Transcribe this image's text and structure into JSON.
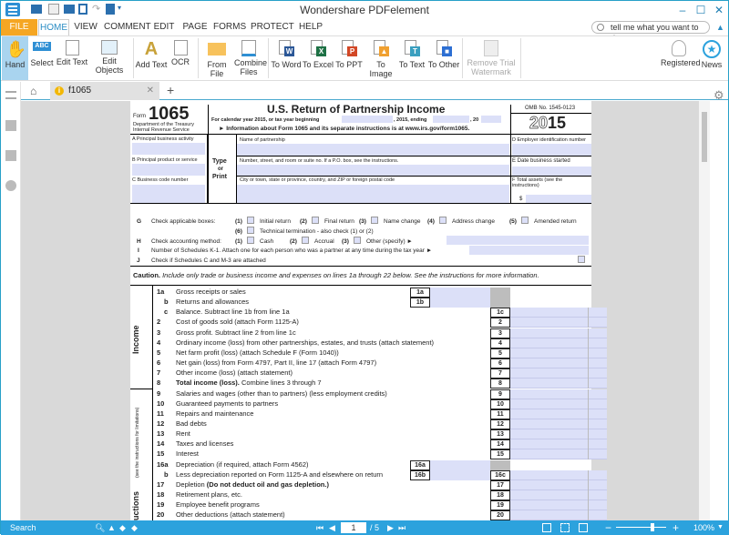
{
  "app": {
    "title": "Wondershare PDFelement",
    "window_controls": {
      "minimize": "–",
      "maximize": "☐",
      "close": "✕"
    }
  },
  "quick_access": [
    "open-icon",
    "save-icon",
    "print-icon",
    "find-icon",
    "redo-icon",
    "export-icon",
    "customize-dropdown-icon"
  ],
  "menu": {
    "tabs": [
      "FILE",
      "HOME",
      "VIEW",
      "COMMENT",
      "EDIT",
      "PAGE",
      "FORMS",
      "PROTECT",
      "HELP"
    ],
    "active": "HOME",
    "search_placeholder": "tell me what you want to do"
  },
  "ribbon": {
    "buttons": [
      {
        "label": "Hand",
        "icon": "hand-icon",
        "selected": true
      },
      {
        "label": "Select",
        "icon": "select-text-icon"
      },
      {
        "label": "Edit Text",
        "icon": "edit-text-icon"
      },
      {
        "label": "Edit Objects",
        "icon": "edit-objects-icon"
      },
      {
        "label": "Add Text",
        "icon": "add-text-icon"
      },
      {
        "label": "OCR",
        "icon": "ocr-icon"
      },
      {
        "label": "From File",
        "icon": "folder-icon"
      },
      {
        "label": "Combine Files",
        "icon": "combine-files-icon"
      },
      {
        "label": "To Word",
        "icon": "word-icon",
        "badge": "W",
        "color": "#2b5797"
      },
      {
        "label": "To Excel",
        "icon": "excel-icon",
        "badge": "X",
        "color": "#1e7145"
      },
      {
        "label": "To PPT",
        "icon": "ppt-icon",
        "badge": "P",
        "color": "#d24726"
      },
      {
        "label": "To Image",
        "icon": "image-icon",
        "badge": "▲",
        "color": "#f0a030"
      },
      {
        "label": "To Text",
        "icon": "text-icon",
        "badge": "T",
        "color": "#3a9fbf"
      },
      {
        "label": "To Other",
        "icon": "other-format-icon",
        "badge": "■",
        "color": "#2d6fd3"
      },
      {
        "label": "Remove Trial Watermark",
        "icon": "remove-watermark-icon",
        "disabled": true
      },
      {
        "label": "Registered",
        "icon": "registered-user-icon"
      },
      {
        "label": "News",
        "icon": "news-star-icon"
      }
    ]
  },
  "document_tabs": {
    "home_icon": "home-icon",
    "tabs": [
      {
        "label": "f1065",
        "icon": "info-icon"
      }
    ],
    "close": "✕",
    "add": "+"
  },
  "form": {
    "form_label": "Form",
    "form_number": "1065",
    "department": "Department of the Treasury",
    "service": "Internal Revenue Service",
    "title": "U.S. Return of Partnership Income",
    "year_line": "For calendar year 2015, or tax year beginning",
    "year_mid": ", 2015, ending",
    "year_end": ", 20",
    "info_line": "► Information about Form 1065 and its separate instructions is at www.irs.gov/form1065.",
    "omb": "OMB No. 1545-0123",
    "year": "2015",
    "year_prefix": "20",
    "year_suffix": "15",
    "A": "A  Principal business activity",
    "B": "B  Principal product or service",
    "C": "C  Business code number",
    "type_or_print": [
      "Type",
      "or",
      "Print"
    ],
    "name_label": "Name of partnership",
    "street_label": "Number, street, and room or suite no. If a P.O. box, see the instructions.",
    "city_label": "City or town, state or province, country, and ZIP or foreign postal code",
    "D": "D  Employer identification number",
    "E": "E  Date business started",
    "F": "F  Total assets (see the instructions)",
    "dollar": "$",
    "G_letter": "G",
    "G_label": "Check applicable boxes:",
    "G_options": [
      {
        "num": "(1)",
        "label": "Initial return"
      },
      {
        "num": "(2)",
        "label": "Final return"
      },
      {
        "num": "(3)",
        "label": "Name change"
      },
      {
        "num": "(4)",
        "label": "Address change"
      },
      {
        "num": "(5)",
        "label": "Amended return"
      },
      {
        "num": "(6)",
        "label": "Technical termination - also check (1) or (2)"
      }
    ],
    "H_letter": "H",
    "H_label": "Check accounting method:",
    "H_options": [
      {
        "num": "(1)",
        "label": "Cash"
      },
      {
        "num": "(2)",
        "label": "Accrual"
      },
      {
        "num": "(3)",
        "label": "Other (specify) ►"
      }
    ],
    "I_letter": "I",
    "I_label": "Number of Schedules K-1. Attach one for each person who was a partner at any time during the tax year ►",
    "J_letter": "J",
    "J_label": "Check if Schedules C and M-3 are attached",
    "caution_bold": "Caution.",
    "caution_text": " Include only trade or business income and expenses on lines 1a through 22 below. See the instructions for more information.",
    "section_income": "Income",
    "section_deductions": "Deductions",
    "section_deductions_note": "(see the instructions for limitations)",
    "lines": [
      {
        "num": "1a",
        "desc": "Gross receipts or sales",
        "box": "1a",
        "inner": true
      },
      {
        "num": "b",
        "desc": "Returns and allowances",
        "box": "1b",
        "inner": true
      },
      {
        "num": "c",
        "desc": "Balance. Subtract line 1b from line 1a",
        "box": "1c"
      },
      {
        "num": "2",
        "desc": "Cost of goods sold (attach Form 1125-A)",
        "box": "2"
      },
      {
        "num": "3",
        "desc": "Gross profit. Subtract line 2 from line 1c",
        "box": "3"
      },
      {
        "num": "4",
        "desc": "Ordinary income (loss) from other partnerships, estates, and trusts (attach statement)",
        "box": "4"
      },
      {
        "num": "5",
        "desc": "Net farm profit (loss) (attach Schedule F (Form 1040))",
        "box": "5"
      },
      {
        "num": "6",
        "desc": "Net gain (loss) from Form 4797, Part II, line 17 (attach Form 4797)",
        "box": "6"
      },
      {
        "num": "7",
        "desc": "Other income (loss) (attach statement)",
        "box": "7"
      },
      {
        "num": "8",
        "desc_bold": "Total income (loss).",
        "desc": " Combine lines 3 through 7",
        "box": "8"
      },
      {
        "num": "9",
        "desc": "Salaries and wages (other than to partners) (less employment credits)",
        "box": "9"
      },
      {
        "num": "10",
        "desc": "Guaranteed payments to partners",
        "box": "10"
      },
      {
        "num": "11",
        "desc": "Repairs and maintenance",
        "box": "11"
      },
      {
        "num": "12",
        "desc": "Bad debts",
        "box": "12"
      },
      {
        "num": "13",
        "desc": "Rent",
        "box": "13"
      },
      {
        "num": "14",
        "desc": "Taxes and licenses",
        "box": "14"
      },
      {
        "num": "15",
        "desc": "Interest",
        "box": "15"
      },
      {
        "num": "16a",
        "desc": "Depreciation (if required, attach Form 4562)",
        "box": "16a",
        "inner": true
      },
      {
        "num": "b",
        "desc": "Less depreciation reported on Form 1125-A and elsewhere on return",
        "box": "16b",
        "inner": true,
        "outer_box": "16c"
      },
      {
        "num": "17",
        "desc": "Depletion ",
        "desc_bold_after": "(Do not deduct oil and gas depletion.)",
        "box": "17"
      },
      {
        "num": "18",
        "desc": "Retirement plans, etc.",
        "box": "18"
      },
      {
        "num": "19",
        "desc": "Employee benefit programs",
        "box": "19"
      },
      {
        "num": "20",
        "desc": "Other deductions (attach statement)",
        "box": "20"
      }
    ]
  },
  "statusbar": {
    "search_label": "Search",
    "current_page": "1",
    "total_pages": "/ 5",
    "zoom": "100%",
    "zoom_fraction": 0.72
  },
  "colors": {
    "accent": "#2ca2dd",
    "file_tab": "#f5a623",
    "field_fill": "#dce0f8"
  }
}
